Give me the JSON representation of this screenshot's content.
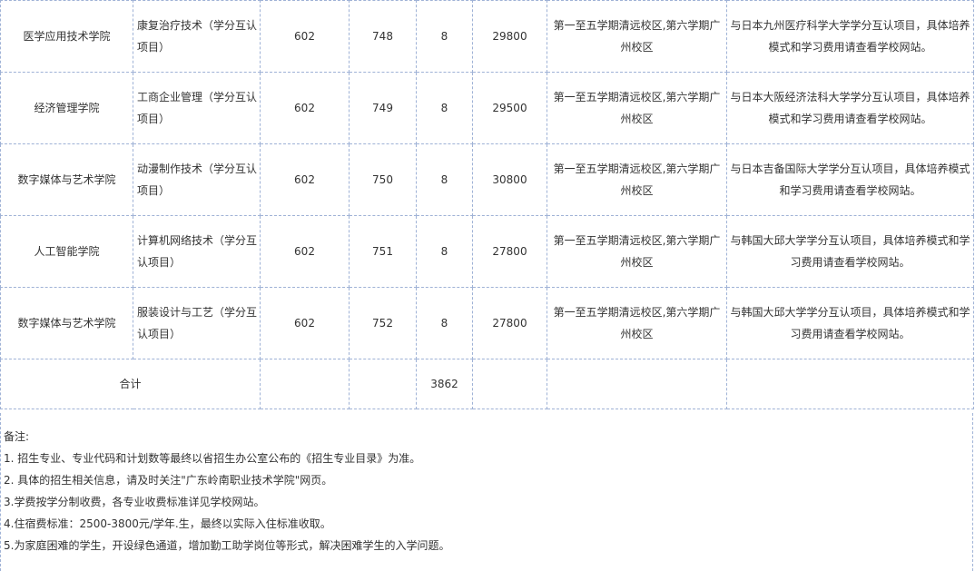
{
  "rows": [
    {
      "college": "医学应用技术学院",
      "major": "康复治疗技术（学分互认项目）",
      "code": "602",
      "major_code": "748",
      "plan": "8",
      "tuition": "29800",
      "campus": "第一至五学期清远校区,第六学期广州校区",
      "remark": "与日本九州医疗科学大学学分互认项目，具体培养模式和学习费用请查看学校网站。"
    },
    {
      "college": "经济管理学院",
      "major": "工商企业管理（学分互认项目）",
      "code": "602",
      "major_code": "749",
      "plan": "8",
      "tuition": "29500",
      "campus": "第一至五学期清远校区,第六学期广州校区",
      "remark": "与日本大阪经济法科大学学分互认项目，具体培养模式和学习费用请查看学校网站。"
    },
    {
      "college": "数字媒体与艺术学院",
      "major": "动漫制作技术（学分互认项目）",
      "code": "602",
      "major_code": "750",
      "plan": "8",
      "tuition": "30800",
      "campus": "第一至五学期清远校区,第六学期广州校区",
      "remark": "与日本吉备国际大学学分互认项目，具体培养模式和学习费用请查看学校网站。"
    },
    {
      "college": "人工智能学院",
      "major": "计算机网络技术（学分互认项目）",
      "code": "602",
      "major_code": "751",
      "plan": "8",
      "tuition": "27800",
      "campus": "第一至五学期清远校区,第六学期广州校区",
      "remark": "与韩国大邱大学学分互认项目，具体培养模式和学习费用请查看学校网站。"
    },
    {
      "college": "数字媒体与艺术学院",
      "major": "服装设计与工艺（学分互认项目）",
      "code": "602",
      "major_code": "752",
      "plan": "8",
      "tuition": "27800",
      "campus": "第一至五学期清远校区,第六学期广州校区",
      "remark": "与韩国大邱大学学分互认项目，具体培养模式和学习费用请查看学校网站。"
    }
  ],
  "total": {
    "label": "合计",
    "plan": "3862"
  },
  "notes": {
    "title": "备注:",
    "items": [
      "1. 招生专业、专业代码和计划数等最终以省招生办公室公布的《招生专业目录》为准。",
      "2. 具体的招生相关信息，请及时关注\"广东岭南职业技术学院\"网页。",
      "3.学费按学分制收费，各专业收费标准详见学校网站。",
      "4.住宿费标准：2500-3800元/学年.生，最终以实际入住标准收取。",
      "5.为家庭困难的学生，开设绿色通道，增加勤工助学岗位等形式，解决困难学生的入学问题。"
    ]
  },
  "colors": {
    "grid_border": "#9fb2d6",
    "text": "#333333"
  }
}
